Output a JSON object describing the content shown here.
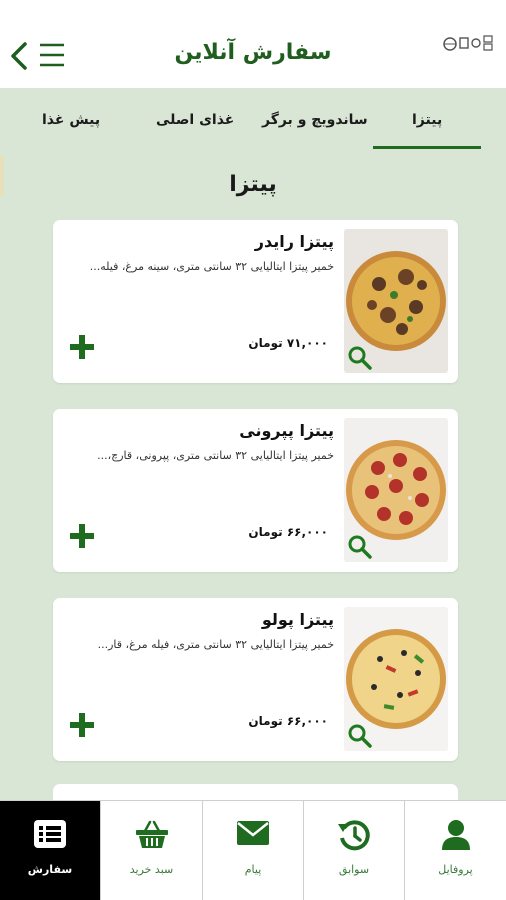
{
  "header": {
    "title": "سفارش آنلاین",
    "back_icon": "chevron-left-icon",
    "menu_icon": "hamburger-menu-icon",
    "logo": "brand-logo"
  },
  "tabs": [
    {
      "label": "پیتزا",
      "active": true
    },
    {
      "label": "ساندویچ و برگر",
      "active": false
    },
    {
      "label": "غذای اصلی",
      "active": false
    },
    {
      "label": "پیش غذا",
      "active": false
    }
  ],
  "section": {
    "title": "پیتزا"
  },
  "items": [
    {
      "name": "پیتزا رایدر",
      "description": "خمیر پیتزا ایتالیایی ۳۲ سانتی متری، سینه مرغ، فیله...",
      "price": "۷۱,۰۰۰ تومان",
      "image": "pizza-rider"
    },
    {
      "name": "پیتزا پپرونی",
      "description": "خمیر پیتزا ایتالیایی ۳۲ سانتی متری، پپرونی، قارچ،...",
      "price": "۶۶,۰۰۰ تومان",
      "image": "pizza-pepperoni"
    },
    {
      "name": "پیتزا پولو",
      "description": "خمیر پیتزا ایتالیایی ۳۲ سانتی متری، فیله مرغ، قار...",
      "price": "۶۶,۰۰۰ تومان",
      "image": "pizza-pollo"
    }
  ],
  "bottom_nav": [
    {
      "label": "سفارش",
      "icon": "list-icon",
      "active": true
    },
    {
      "label": "سبد خرید",
      "icon": "basket-icon",
      "active": false
    },
    {
      "label": "پیام",
      "icon": "envelope-icon",
      "active": false
    },
    {
      "label": "سوابق",
      "icon": "history-icon",
      "active": false
    },
    {
      "label": "پروفایل",
      "icon": "user-icon",
      "active": false
    }
  ],
  "colors": {
    "accent": "#1f6b1f",
    "background": "#d9e6d5",
    "nav_active": "#000000"
  }
}
